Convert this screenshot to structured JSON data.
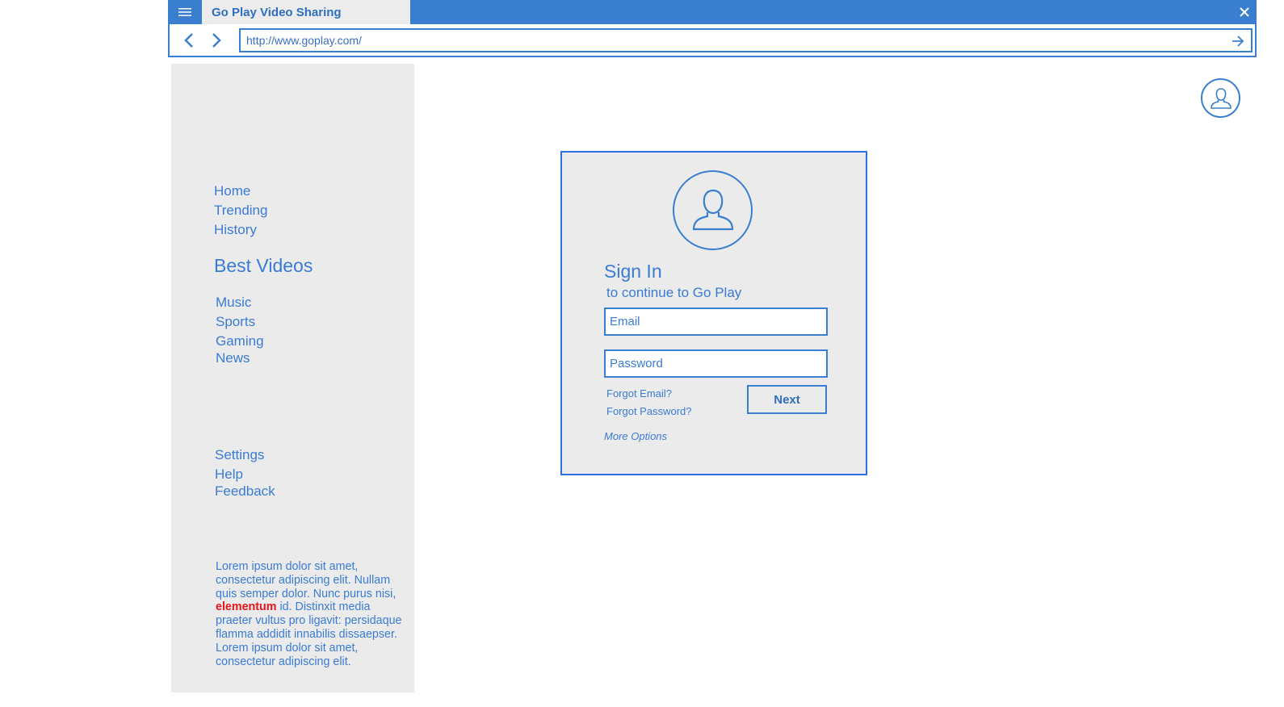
{
  "browser": {
    "tab_title": "Go Play Video Sharing",
    "url": "http://www.goplay.com/",
    "icons": {
      "menu": "hamburger-icon",
      "close": "close-icon",
      "back": "chevron-left-icon",
      "forward": "chevron-right-icon",
      "go": "arrow-right-icon"
    },
    "accent_color": "#3a7fcf"
  },
  "sidebar": {
    "primary_links": [
      {
        "label": "Home"
      },
      {
        "label": "Trending"
      },
      {
        "label": "History"
      }
    ],
    "section_heading": "Best Videos",
    "category_links": [
      {
        "label": "Music"
      },
      {
        "label": "Sports"
      },
      {
        "label": "Gaming"
      },
      {
        "label": "News"
      }
    ],
    "footer_links": [
      {
        "label": "Settings"
      },
      {
        "label": "Help"
      },
      {
        "label": "Feedback"
      }
    ],
    "lorem": {
      "before": "Lorem ipsum dolor sit amet, consectetur adipiscing elit. Nullam quis semper dolor. Nunc purus nisi, ",
      "highlight": "elementum",
      "after": " id. Distinxit  media praeter vultus pro ligavit: persidaque flamma addidit innabilis dissaepser. Lorem ipsum dolor sit amet, consectetur adipiscing elit."
    },
    "background_color": "#ebebeb"
  },
  "header": {
    "account_icon": "user-avatar-icon"
  },
  "signin": {
    "avatar_icon": "user-avatar-icon",
    "title": "Sign In",
    "subtitle": "to continue to Go Play",
    "email_placeholder": "Email",
    "password_placeholder": "Password",
    "forgot_email": "Forgot Email?",
    "forgot_password": "Forgot Password?",
    "next_label": "Next",
    "more_options": "More Options",
    "border_color": "#2c6fe0"
  },
  "colors": {
    "text_blue": "#3a7bd5",
    "highlight_red": "#e8141a"
  }
}
